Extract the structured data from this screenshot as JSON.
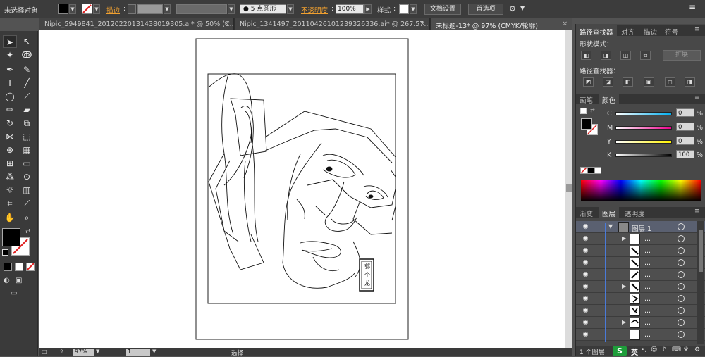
{
  "control_bar": {
    "selection_status": "未选择对象",
    "stroke_label": "描边",
    "brush_label": "5 点圆形",
    "opacity_label": "不透明度",
    "opacity_value": "100%",
    "style_label": "样式",
    "doc_setup_button": "文档设置",
    "preferences_button": "首选项"
  },
  "tabs": [
    {
      "label": "Nipic_5949841_20120220131438019305.ai* @ 50% (C..."
    },
    {
      "label": "Nipic_1341497_20110426101239326336.ai* @ 267.57..."
    },
    {
      "label": "未标题-13* @ 97% (CMYK/轮廓)"
    }
  ],
  "pathfinder_panel": {
    "tabs": [
      "路径查找器",
      "对齐",
      "描边",
      "符号"
    ],
    "shape_modes_label": "形状模式：",
    "expand_button": "扩展",
    "pathfinders_label": "路径查找器："
  },
  "color_panel": {
    "tabs": [
      "画笔",
      "颜色"
    ],
    "channels": [
      {
        "label": "C",
        "value": "0",
        "unit": "%"
      },
      {
        "label": "M",
        "value": "0",
        "unit": "%"
      },
      {
        "label": "Y",
        "value": "0",
        "unit": "%"
      },
      {
        "label": "K",
        "value": "100",
        "unit": "%"
      }
    ]
  },
  "layers_panel": {
    "tabs": [
      "渐变",
      "图层",
      "透明度"
    ],
    "top_layer_name": "图层 1",
    "sublayer_name": "...",
    "footer_count": "1 个图层"
  },
  "status_bar": {
    "zoom": "97%",
    "page": "1",
    "mode": "选择"
  },
  "taskbar": {
    "ime_label": "英"
  },
  "artwork": {
    "stamp_text": [
      "郭",
      "个",
      "龙"
    ]
  },
  "colors": {
    "bg": "#535353",
    "panel": "#484848",
    "accent_orange": "#f0a030",
    "fill": "#000000"
  }
}
